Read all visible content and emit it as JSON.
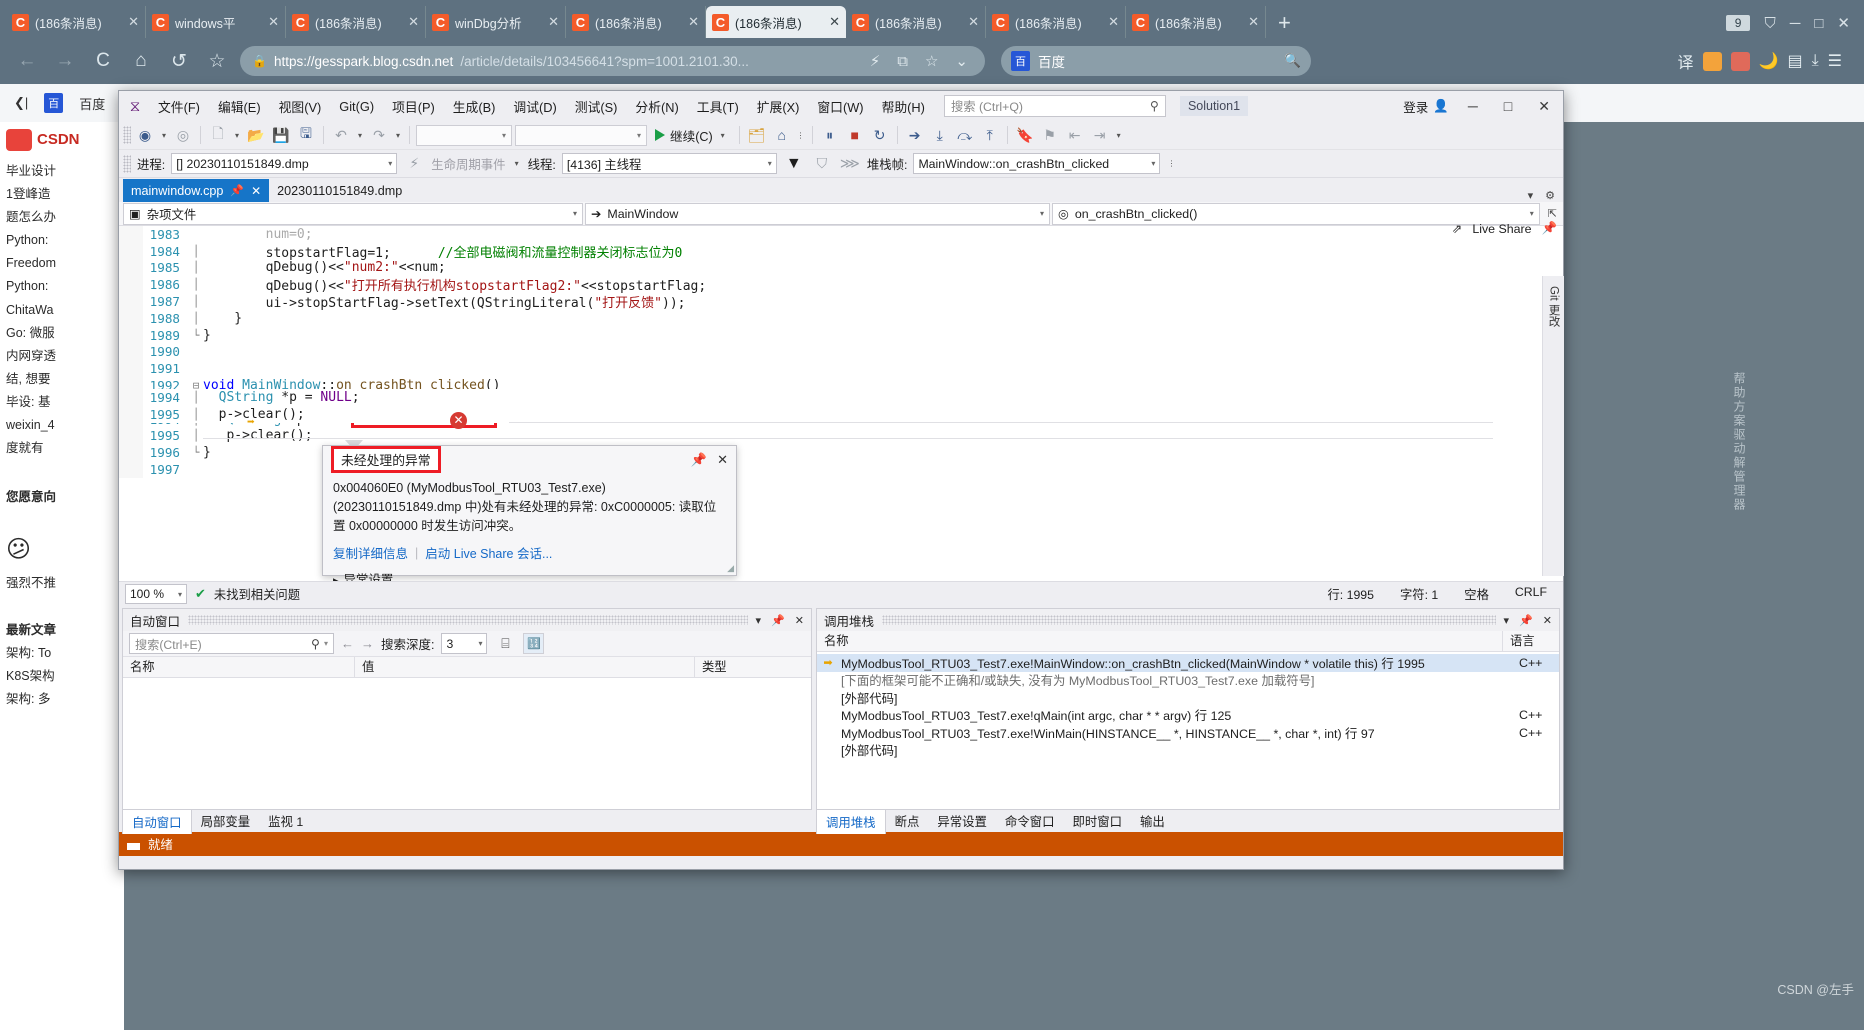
{
  "browser": {
    "tabs": [
      {
        "label": "(186条消息)",
        "favicon": "csdn-icon",
        "active": false
      },
      {
        "label": "windows平",
        "favicon": "csdn-icon",
        "active": false
      },
      {
        "label": "(186条消息)",
        "favicon": "csdn-icon",
        "active": false
      },
      {
        "label": "winDbg分析",
        "favicon": "csdn-icon",
        "active": false
      },
      {
        "label": "(186条消息)",
        "favicon": "csdn-icon",
        "active": false
      },
      {
        "label": "(186条消息)",
        "favicon": "csdn-icon",
        "active": true
      },
      {
        "label": "(186条消息)",
        "favicon": "csdn-icon",
        "active": false
      },
      {
        "label": "(186条消息)",
        "favicon": "csdn-icon",
        "active": false
      },
      {
        "label": "(186条消息)",
        "favicon": "csdn-icon",
        "active": false
      }
    ],
    "new_tab": "+",
    "window_count": "9",
    "url_host": "https://gesspark.blog.csdn.net",
    "url_path": "/article/details/103456641?spm=1001.2101.30...",
    "search_engine": "百度",
    "search_placeholder": "",
    "nav": {
      "back": "←",
      "forward": "→",
      "reload": "C",
      "home": "⌂",
      "history": "↺",
      "bookmark": "☆"
    }
  },
  "csdn": {
    "logo": "CSDN",
    "nav_label": "百度",
    "sidebar": [
      "毕业设计",
      "1登峰造",
      "题怎么办",
      "Python:",
      "Freedom",
      "Python:",
      "ChitaWa",
      "Go: 微服",
      "内网穿透",
      "结, 想要",
      "毕设: 基",
      "weixin_4",
      "度就有",
      "您愿意向",
      "强烈不推",
      "最新文章",
      "架构: To",
      "K8S架构",
      "架构: 多"
    ],
    "watermark": "CSDN @左手",
    "rail_text": "帮助方案驱动解管理器"
  },
  "vs": {
    "menu": [
      "文件(F)",
      "编辑(E)",
      "视图(V)",
      "Git(G)",
      "项目(P)",
      "生成(B)",
      "调试(D)",
      "测试(S)",
      "分析(N)",
      "工具(T)",
      "扩展(X)",
      "窗口(W)",
      "帮助(H)"
    ],
    "search_placeholder": "搜索 (Ctrl+Q)",
    "solution_name": "Solution1",
    "login_label": "登录",
    "live_share_label": "Live Share",
    "window_buttons": {
      "minimize": "─",
      "maximize": "□",
      "close": "✕"
    },
    "toolbar": {
      "continue_label": "继续(C)",
      "combo1": "",
      "combo2": ""
    },
    "debugbar": {
      "process_label": "进程:",
      "process_value": "[] 20230110151849.dmp",
      "lifecycle_label": "生命周期事件",
      "thread_label": "线程:",
      "thread_value": "[4136] 主线程",
      "frame_label": "堆栈帧:",
      "frame_value": "MainWindow::on_crashBtn_clicked"
    },
    "editor": {
      "tabs": [
        {
          "label": "mainwindow.cpp",
          "active": true
        },
        {
          "label": "20230110151849.dmp",
          "active": false
        }
      ],
      "nav_project": "杂项文件",
      "nav_class": "MainWindow",
      "nav_member": "on_crashBtn_clicked()",
      "lines": [
        {
          "n": "1983",
          "text": "num=0;",
          "partial": true
        },
        {
          "n": "1984",
          "text": "stopstartFlag=1;",
          "comment": "//全部电磁阀和流量控制器关闭标志位为0"
        },
        {
          "n": "1985",
          "text": "qDebug()<<\"num2:\"<<num;"
        },
        {
          "n": "1986",
          "text": "qDebug()<<\"打开所有执行机构stopstartFlag2:\"<<stopstartFlag;"
        },
        {
          "n": "1987",
          "text": "ui->stopStartFlag->setText(QStringLiteral(\"打开反馈\"));"
        },
        {
          "n": "1988",
          "text": "}"
        },
        {
          "n": "1989",
          "text": "}"
        },
        {
          "n": "1990",
          "text": ""
        },
        {
          "n": "1991",
          "text": ""
        },
        {
          "n": "1992",
          "text": "void MainWindow::on_crashBtn_clicked()"
        },
        {
          "n": "1993",
          "text": "{"
        },
        {
          "n": "1994",
          "text": "QString *p = NULL;"
        },
        {
          "n": "1995",
          "text": "p->clear();"
        },
        {
          "n": "1996",
          "text": "}"
        },
        {
          "n": "1997",
          "text": ""
        }
      ]
    },
    "exception": {
      "title": "未经处理的异常",
      "body": "0x004060E0 (MyModbusTool_RTU03_Test7.exe) (20230110151849.dmp 中)处有未经处理的异常: 0xC0000005: 读取位置 0x00000000 时发生访问冲突。",
      "link_copy": "复制详细信息",
      "link_liveshare": "启动 Live Share 会话...",
      "settings": "异常设置",
      "pin_icon": "pin-icon",
      "close_icon": "close-icon"
    },
    "editor_status": {
      "zoom": "100 %",
      "issues": "未找到相关问题",
      "line": "行: 1995",
      "col": "字符: 1",
      "spaces": "空格",
      "eol": "CRLF"
    },
    "autos": {
      "title": "自动窗口",
      "search_placeholder": "搜索(Ctrl+E)",
      "depth_label": "搜索深度:",
      "depth_value": "3",
      "columns": [
        "名称",
        "值",
        "类型"
      ],
      "rows": [],
      "tabs": [
        {
          "label": "自动窗口",
          "active": true
        },
        {
          "label": "局部变量",
          "active": false
        },
        {
          "label": "监视 1",
          "active": false
        }
      ]
    },
    "callstack": {
      "title": "调用堆栈",
      "columns": [
        "名称",
        "语言"
      ],
      "rows": [
        {
          "name": "MyModbusTool_RTU03_Test7.exe!MainWindow::on_crashBtn_clicked(MainWindow * volatile this) 行 1995",
          "lang": "C++",
          "current": true,
          "dim": false
        },
        {
          "name": "[下面的框架可能不正确和/或缺失, 没有为 MyModbusTool_RTU03_Test7.exe 加载符号]",
          "lang": "",
          "current": false,
          "dim": true
        },
        {
          "name": "[外部代码]",
          "lang": "",
          "current": false,
          "dim": false
        },
        {
          "name": "MyModbusTool_RTU03_Test7.exe!qMain(int argc, char * * argv) 行 125",
          "lang": "C++",
          "current": false,
          "dim": false
        },
        {
          "name": "MyModbusTool_RTU03_Test7.exe!WinMain(HINSTANCE__ *, HINSTANCE__ *, char *, int) 行 97",
          "lang": "C++",
          "current": false,
          "dim": false
        },
        {
          "name": "[外部代码]",
          "lang": "",
          "current": false,
          "dim": false
        }
      ],
      "tabs": [
        {
          "label": "调用堆栈",
          "active": true
        },
        {
          "label": "断点",
          "active": false
        },
        {
          "label": "异常设置",
          "active": false
        },
        {
          "label": "命令窗口",
          "active": false
        },
        {
          "label": "即时窗口",
          "active": false
        },
        {
          "label": "输出",
          "active": false
        }
      ]
    },
    "status_bar": {
      "text": "就绪"
    },
    "rail": [
      "Git 更改"
    ]
  },
  "colors": {
    "accent_blue": "#1675c8",
    "red_box": "#ee1c25",
    "status_orange": "#ca5100",
    "csdn_red": "#c72a22",
    "browser_chrome": "#5e7180"
  }
}
